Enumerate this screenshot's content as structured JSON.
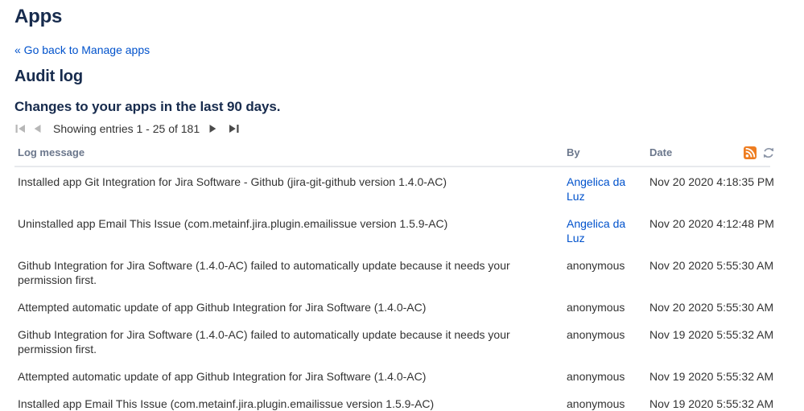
{
  "page": {
    "title": "Apps",
    "back_link_label": "« Go back to Manage apps",
    "section_title": "Audit log",
    "subtitle": "Changes to your apps in the last 90 days."
  },
  "pagination": {
    "label": "Showing entries 1 - 25 of 181",
    "first_enabled": false,
    "prev_enabled": false,
    "next_enabled": true,
    "last_enabled": true
  },
  "table": {
    "headers": {
      "message": "Log message",
      "by": "By",
      "date": "Date"
    },
    "rows": [
      {
        "message": "Installed app Git Integration for Jira Software - Github (jira-git-github version 1.4.0-AC)",
        "by": "Angelica da Luz",
        "by_is_link": true,
        "date": "Nov 20 2020 4:18:35 PM"
      },
      {
        "message": "Uninstalled app Email This Issue (com.metainf.jira.plugin.emailissue version 1.5.9-AC)",
        "by": "Angelica da Luz",
        "by_is_link": true,
        "date": "Nov 20 2020 4:12:48 PM"
      },
      {
        "message": "Github Integration for Jira Software (1.4.0-AC) failed to automatically update because it needs your permission first.",
        "by": "anonymous",
        "by_is_link": false,
        "date": "Nov 20 2020 5:55:30 AM"
      },
      {
        "message": "Attempted automatic update of app Github Integration for Jira Software (1.4.0-AC)",
        "by": "anonymous",
        "by_is_link": false,
        "date": "Nov 20 2020 5:55:30 AM"
      },
      {
        "message": "Github Integration for Jira Software (1.4.0-AC) failed to automatically update because it needs your permission first.",
        "by": "anonymous",
        "by_is_link": false,
        "date": "Nov 19 2020 5:55:32 AM"
      },
      {
        "message": "Attempted automatic update of app Github Integration for Jira Software (1.4.0-AC)",
        "by": "anonymous",
        "by_is_link": false,
        "date": "Nov 19 2020 5:55:32 AM"
      },
      {
        "message": "Installed app Email This Issue (com.metainf.jira.plugin.emailissue version 1.5.9-AC)",
        "by": "anonymous",
        "by_is_link": false,
        "date": "Nov 19 2020 5:55:32 AM"
      }
    ]
  },
  "icons": {
    "first_page": "first-page-icon",
    "previous_page": "previous-page-icon",
    "next_page": "next-page-icon",
    "last_page": "last-page-icon",
    "rss_feed": "rss-feed-icon",
    "refresh": "refresh-icon"
  },
  "colors": {
    "heading_navy": "#172B4D",
    "link_blue": "#0052CC",
    "body_text": "#333333",
    "muted_header": "#6B778C",
    "table_border": "#e7e9ed",
    "rss_orange": "#EE7D21",
    "refresh_grey": "#8B95A7",
    "pager_disabled": "#b7b7b7",
    "pager_enabled": "#4a4a4a"
  }
}
